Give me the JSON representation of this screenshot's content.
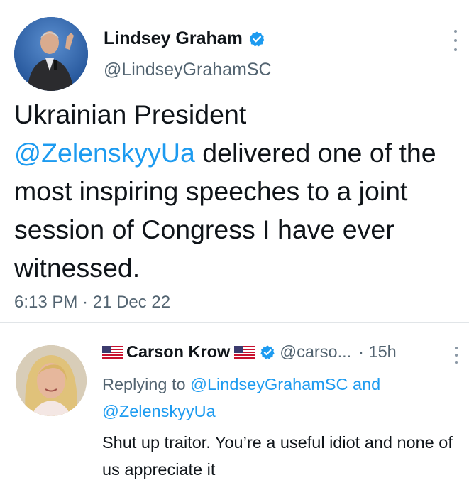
{
  "tweet": {
    "author_name": "Lindsey Graham",
    "author_handle": "@LindseyGrahamSC",
    "text_part1": "Ukrainian President",
    "mention": "@ZelenskyyUa",
    "text_part2": " delivered one of the most inspiring speeches to a joint session of Congress I have ever witnessed.",
    "time": "6:13 PM",
    "separator": " · ",
    "date": "21 Dec 22"
  },
  "reply": {
    "author_name": "Carson Krow",
    "author_handle": "@carso...",
    "separator": "·",
    "time_ago": "15h",
    "replying_prefix": "Replying to ",
    "replying_to_1": "@LindseyGrahamSC",
    "replying_and": " and ",
    "replying_to_2": "@ZelenskyyUa",
    "text": "Shut up traitor. You’re a useful idiot and none of us appreciate it"
  },
  "colors": {
    "link": "#1d9bf0",
    "secondary_text": "#536471",
    "verified": "#1d9bf0"
  },
  "icons": [
    "verified-badge-icon",
    "more-options-icon",
    "us-flag-icon"
  ]
}
